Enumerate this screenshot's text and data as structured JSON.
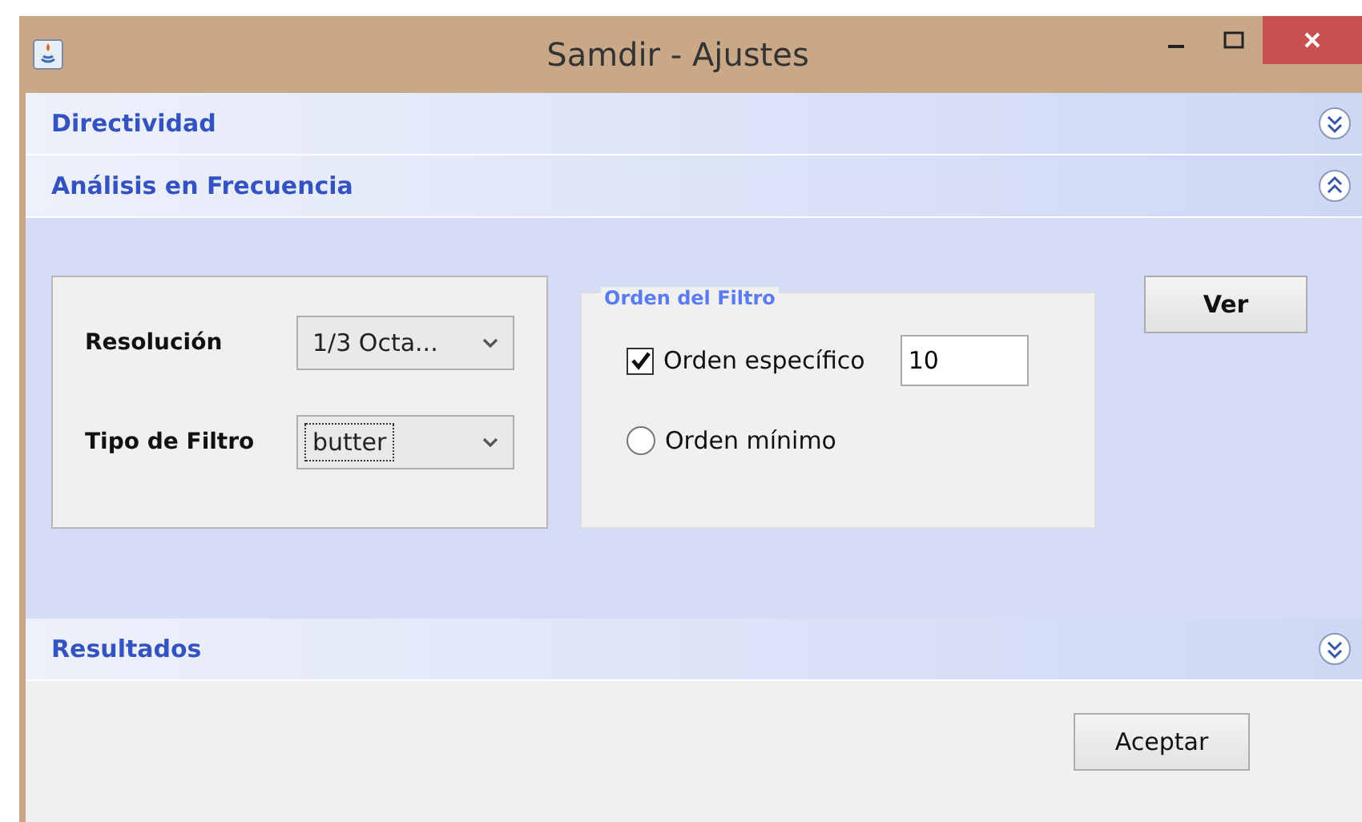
{
  "window": {
    "title": "Samdir - Ajustes"
  },
  "sections": [
    {
      "title": "Directividad",
      "expanded": false
    },
    {
      "title": "Análisis en Frecuencia",
      "expanded": true
    },
    {
      "title": "Resultados",
      "expanded": false
    }
  ],
  "analysis": {
    "fields": [
      {
        "label": "Resolución",
        "value": "1/3 Octa...",
        "focused": false
      },
      {
        "label": "Tipo de Filtro",
        "value": "butter",
        "focused": true
      }
    ],
    "filter_order": {
      "title": "Orden del Filtro",
      "options": [
        {
          "kind": "checkbox",
          "label": "Orden específico",
          "checked": true,
          "value": "10"
        },
        {
          "kind": "radio",
          "label": "Orden mínimo",
          "checked": false
        }
      ]
    },
    "view_button": "Ver"
  },
  "ok_button": "Aceptar"
}
